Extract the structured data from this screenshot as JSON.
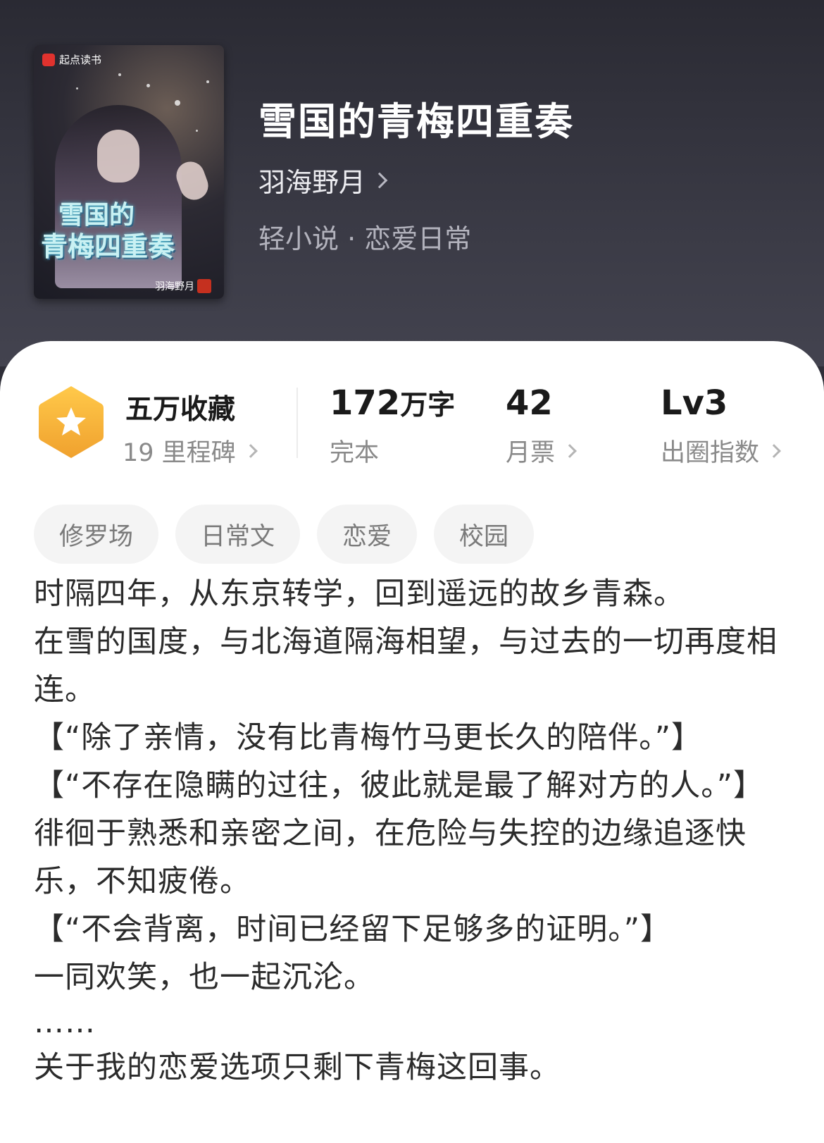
{
  "cover": {
    "brand": "起点读书",
    "title_line1": "雪国的",
    "title_line2": "青梅四重奏",
    "author": "羽海野月",
    "seal": "著"
  },
  "book": {
    "title": "雪国的青梅四重奏",
    "author": "羽海野月",
    "genre": "轻小说 · 恋爱日常"
  },
  "stats": {
    "collect": {
      "primary": "五万收藏",
      "secondary": "19 里程碑",
      "badge_color": "#f5b53c",
      "icon": "star-icon"
    },
    "words": {
      "value": "172",
      "unit": "万字",
      "label": "完本"
    },
    "tickets": {
      "value": "42",
      "label": "月票"
    },
    "level": {
      "value": "Lv3",
      "label": "出圈指数"
    }
  },
  "tags": [
    "修罗场",
    "日常文",
    "恋爱",
    "校园"
  ],
  "synopsis": [
    "时隔四年，从东京转学，回到遥远的故乡青森。",
    "在雪的国度，与北海道隔海相望，与过去的一切再度相连。",
    "【“除了亲情，没有比青梅竹马更长久的陪伴。”】",
    "【“不存在隐瞒的过往，彼此就是最了解对方的人。”】",
    "徘徊于熟悉和亲密之间，在危险与失控的边缘追逐快乐，不知疲倦。",
    "【“不会背离，时间已经留下足够多的证明。”】",
    "一同欢笑，也一起沉沦。",
    "……",
    "关于我的恋爱选项只剩下青梅这回事。"
  ],
  "colors": {
    "header_bg": "#2e2e38",
    "card_bg": "#ffffff",
    "badge": "#f5b53c",
    "tag_bg": "#f4f4f4"
  }
}
